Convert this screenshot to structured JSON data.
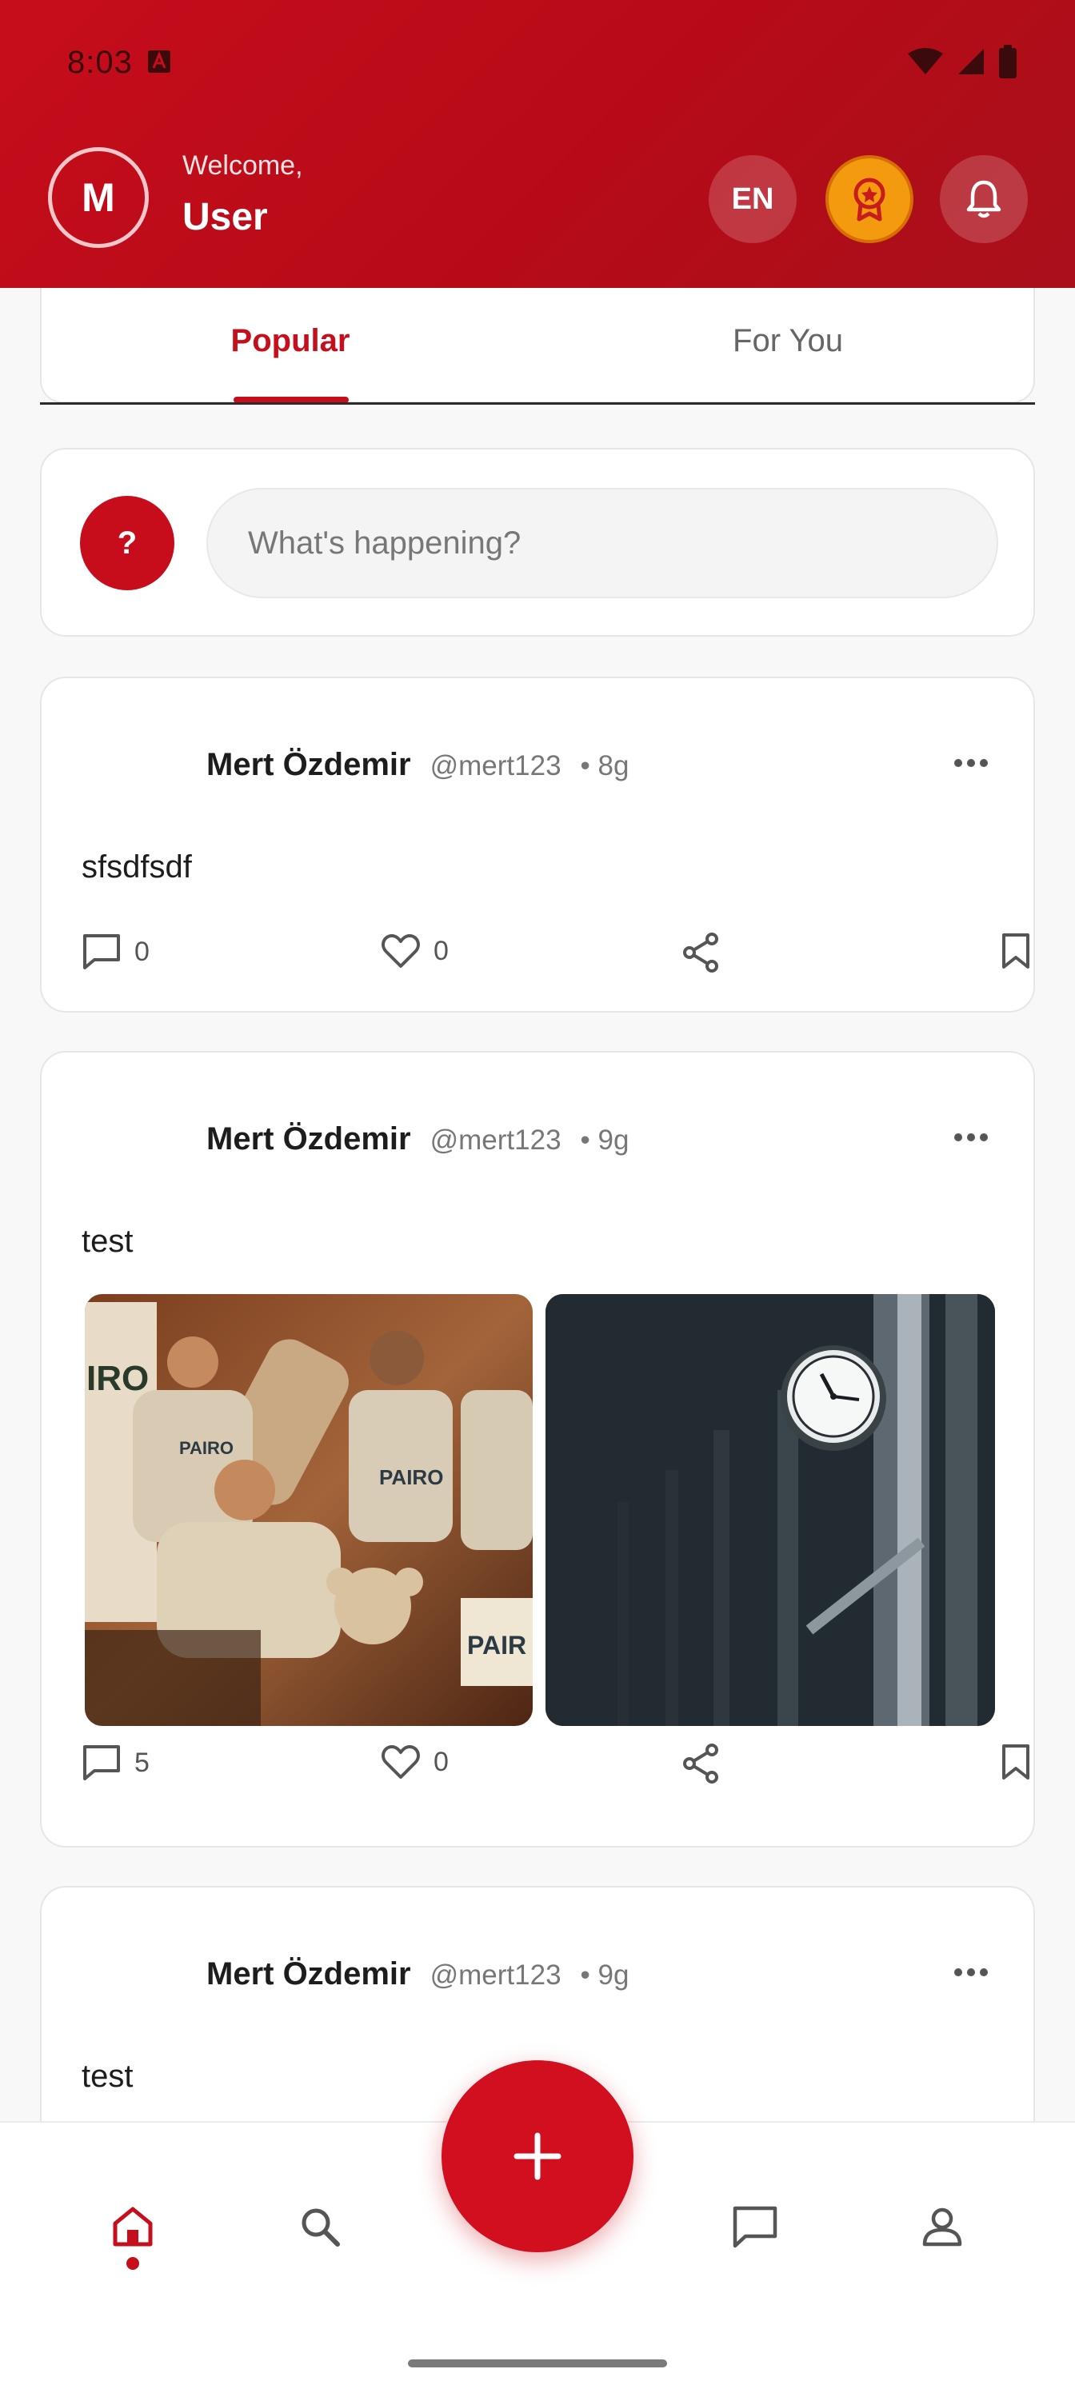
{
  "status_bar": {
    "time": "8:03"
  },
  "header": {
    "avatar_initial": "M",
    "welcome": "Welcome,",
    "username": "User",
    "language": "EN"
  },
  "tabs": [
    {
      "label": "Popular",
      "active": true
    },
    {
      "label": "For You",
      "active": false
    }
  ],
  "composer": {
    "avatar_text": "?",
    "placeholder": "What's happening?"
  },
  "posts": [
    {
      "name": "Mert Özdemir",
      "handle": "@mert123",
      "time": "• 8g",
      "text": "sfsdfsdf",
      "comments": "0",
      "likes": "0",
      "images": []
    },
    {
      "name": "Mert Özdemir",
      "handle": "@mert123",
      "time": "• 9g",
      "text": "test",
      "comments": "5",
      "likes": "0",
      "images": [
        "volunteers-photo",
        "clock-photo"
      ]
    },
    {
      "name": "Mert Özdemir",
      "handle": "@mert123",
      "time": "• 9g",
      "text": "test"
    }
  ],
  "colors": {
    "brand": "#c70d1c",
    "badge": "#f39a0f"
  }
}
